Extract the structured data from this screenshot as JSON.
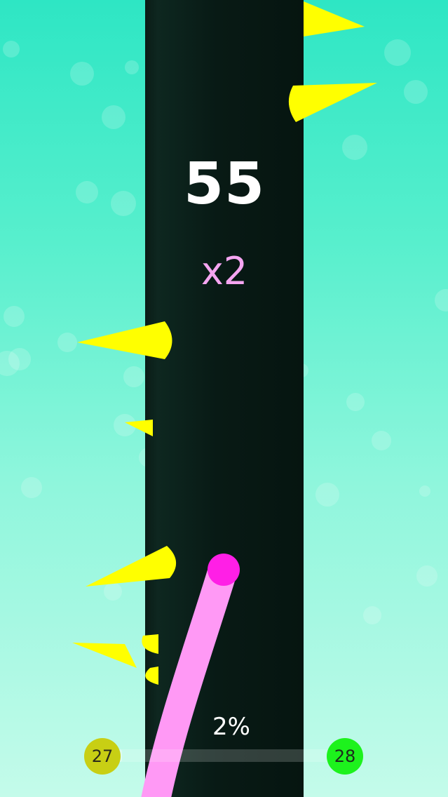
{
  "hud": {
    "score": "55",
    "multiplier": "x2",
    "progress_text": "2%",
    "progress_fraction": 0.02,
    "current_level": "27",
    "next_level": "28"
  },
  "colors": {
    "background_top": "#2ee6c4",
    "background_bottom": "#c4fbea",
    "tower": "#081a15",
    "spike": "#ffff00",
    "player_trail": "#ff99f5",
    "player_ball": "#ff1fe6",
    "score_text": "#ffffff",
    "multiplier_text": "#f5a5f1",
    "current_level_badge": "#c8cf14",
    "next_level_badge": "#1df21d"
  },
  "icons": {
    "obstacle": "spike",
    "player": "ball-with-trail"
  }
}
